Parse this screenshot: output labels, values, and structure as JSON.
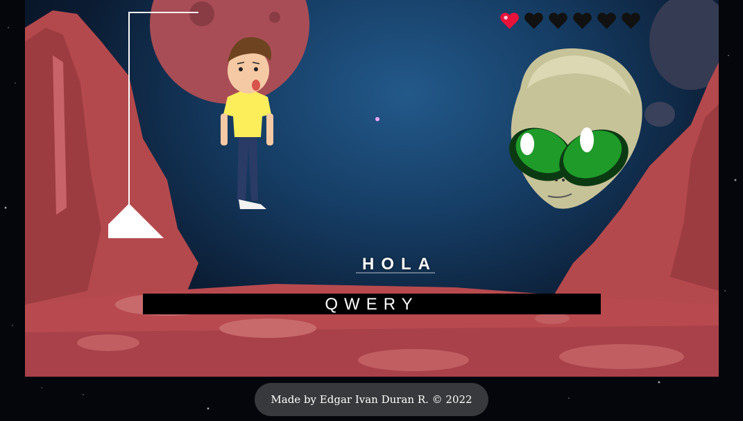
{
  "game": {
    "secret_word": "HOLA",
    "wrong_letters": "QWERY",
    "lives": {
      "total": 6,
      "remaining": 1
    }
  },
  "hearts": [
    {
      "state": "full",
      "icon": "heart-full-icon"
    },
    {
      "state": "lost",
      "icon": "heart-lost-icon"
    },
    {
      "state": "lost",
      "icon": "heart-lost-icon"
    },
    {
      "state": "lost",
      "icon": "heart-lost-icon"
    },
    {
      "state": "lost",
      "icon": "heart-lost-icon"
    },
    {
      "state": "lost",
      "icon": "heart-lost-icon"
    }
  ],
  "colors": {
    "heart_full": "#e8123a",
    "heart_lost": "#111111",
    "shirt": "#fcee5b",
    "alien_eye": "#1f9b2a",
    "rock": "#b24a4e"
  },
  "footer": {
    "credit": "Made by Edgar Ivan Duran R. © 2022"
  }
}
